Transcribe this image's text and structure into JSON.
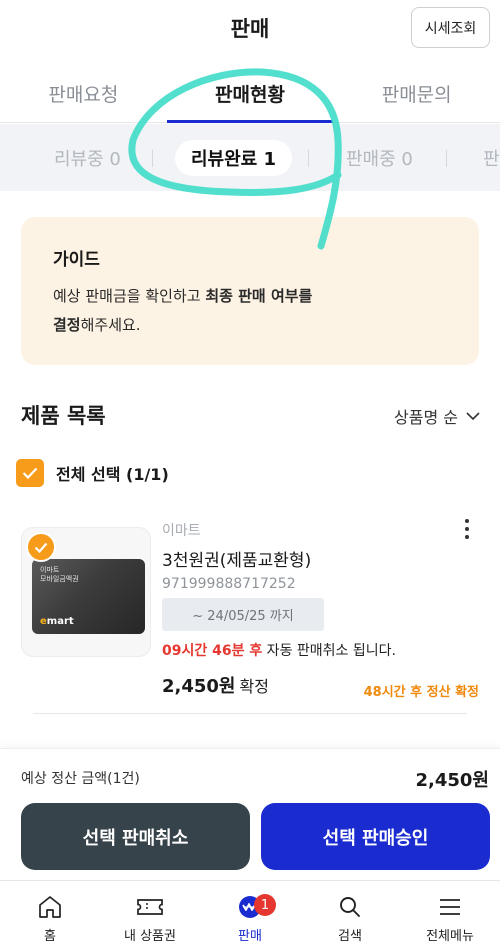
{
  "header": {
    "title": "판매",
    "price_lookup_label": "시세조회"
  },
  "tabs": [
    {
      "label": "판매요청",
      "active": false
    },
    {
      "label": "판매현황",
      "active": true
    },
    {
      "label": "판매문의",
      "active": false
    }
  ],
  "subtabs": [
    {
      "label": "리뷰중 0",
      "active": false
    },
    {
      "label": "리뷰완료 1",
      "active": true
    },
    {
      "label": "판매중 0",
      "active": false
    },
    {
      "label": "판",
      "active": false
    }
  ],
  "guide": {
    "title": "가이드",
    "text_part1": "예상 판매금을 확인하고 ",
    "text_bold1": "최종 판매 여부를",
    "text_bold2": "결정",
    "text_part2": "해주세요."
  },
  "product_list": {
    "title": "제품 목록",
    "sort_label": "상품명 순",
    "select_all_label": "전체 선택 (1/1)",
    "select_all_checked": true
  },
  "product": {
    "brand": "이마트",
    "name": "3천원권(제품교환형)",
    "barcode": "971999888717252",
    "expiry": "~ 24/05/25 까지",
    "countdown_time": "09시간 46분 후",
    "countdown_suffix": " 자동 판매취소 됩니다.",
    "price": "2,450원",
    "price_status": "확정",
    "settlement_note": "48시간 후 정산 확정",
    "checked": true,
    "card_text_line1": "이마트",
    "card_text_line2": "모바일금액권",
    "card_logo": "mart",
    "card_logo_accent": "e"
  },
  "summary": {
    "estimate_label": "예상 정산 금액(1건)",
    "estimate_value": "2,450원",
    "cancel_button": "선택 판매취소",
    "approve_button": "선택 판매승인"
  },
  "bottom_nav": [
    {
      "label": "홈",
      "icon": "home-icon",
      "active": false
    },
    {
      "label": "내 상품권",
      "icon": "ticket-icon",
      "active": false
    },
    {
      "label": "판매",
      "icon": "sell-icon",
      "active": true,
      "badge": "1"
    },
    {
      "label": "검색",
      "icon": "search-icon",
      "active": false
    },
    {
      "label": "전체메뉴",
      "icon": "menu-icon",
      "active": false
    }
  ],
  "colors": {
    "accent_blue": "#1a2cd0",
    "orange": "#f79b1b",
    "red": "#e5372f",
    "annotation": "#3fdcc8"
  }
}
